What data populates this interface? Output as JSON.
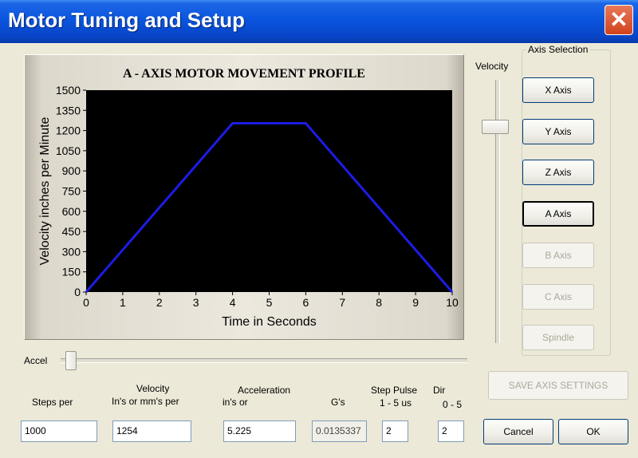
{
  "window": {
    "title": "Motor Tuning and Setup",
    "close_glyph": "✕"
  },
  "chart_data": {
    "type": "line",
    "title": "A - AXIS MOTOR MOVEMENT PROFILE",
    "xlabel": "Time in Seconds",
    "ylabel": "Velocity inches per Minute",
    "xlim": [
      0,
      10
    ],
    "ylim": [
      0,
      1500
    ],
    "xticks": [
      0,
      1,
      2,
      3,
      4,
      5,
      6,
      7,
      8,
      9,
      10
    ],
    "yticks": [
      0,
      150,
      300,
      450,
      600,
      750,
      900,
      1050,
      1200,
      1350,
      1500
    ],
    "series": [
      {
        "x": [
          0,
          4,
          6,
          10
        ],
        "y": [
          0,
          1254,
          1254,
          0
        ]
      }
    ],
    "grid": false,
    "colors": {
      "background": "#000000",
      "line": "#1c1ce6"
    }
  },
  "velocity_slider": {
    "label": "Velocity"
  },
  "accel_slider": {
    "label": "Accel"
  },
  "axis_selection": {
    "title": "Axis Selection",
    "buttons": [
      "X Axis",
      "Y Axis",
      "Z Axis",
      "A Axis",
      "B Axis",
      "C Axis",
      "Spindle"
    ]
  },
  "fields": {
    "steps_per": {
      "label": "Steps per",
      "value": "1000"
    },
    "velocity": {
      "label_line1": "Velocity",
      "label_line2": "In's or mm's per",
      "value": "1254"
    },
    "acceleration": {
      "label_line1": "Acceleration",
      "label_line2": "in's or",
      "value": "5.225"
    },
    "gs": {
      "label": "G's",
      "value": "0.0135337"
    },
    "step_pulse": {
      "label_line1": "Step Pulse",
      "label_line2": "1 - 5 us",
      "value": "2"
    },
    "dir": {
      "label_line1": "Dir",
      "label_line2": "0 - 5",
      "value": "2"
    }
  },
  "actions": {
    "save": "SAVE AXIS SETTINGS",
    "cancel": "Cancel",
    "ok": "OK"
  }
}
